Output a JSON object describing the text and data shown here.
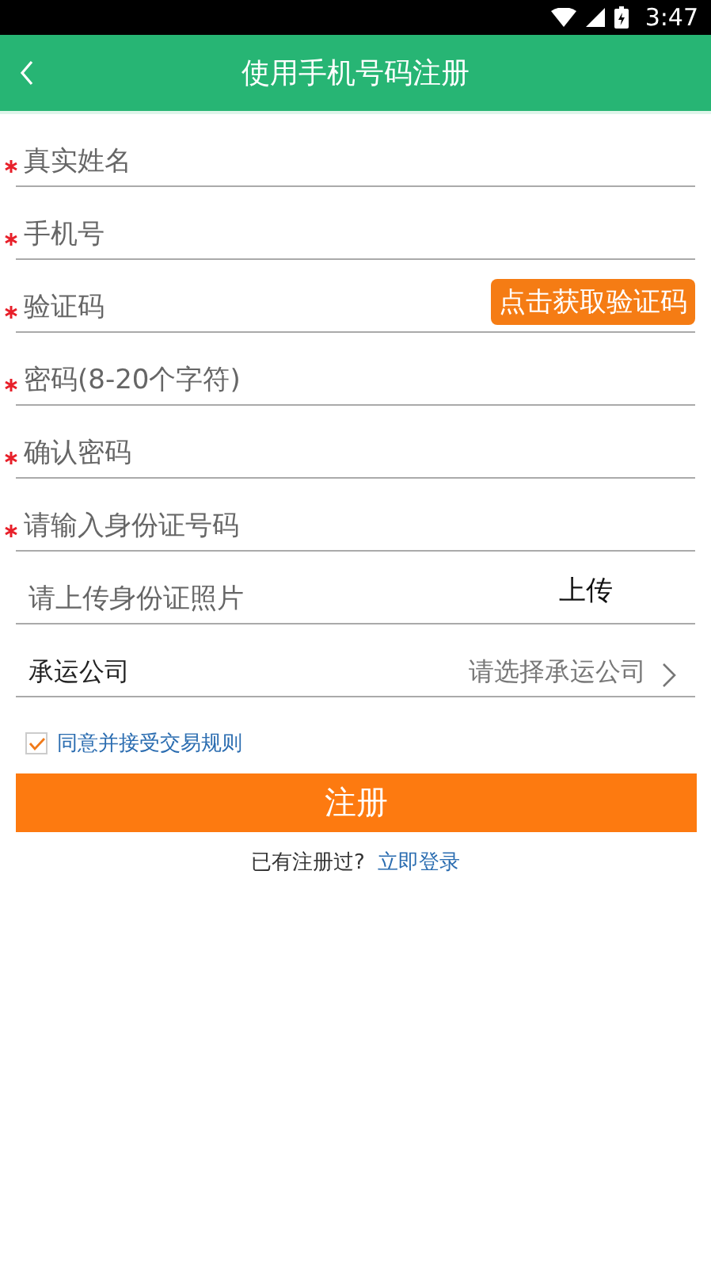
{
  "status_bar": {
    "time": "3:47"
  },
  "header": {
    "title": "使用手机号码注册"
  },
  "fields": [
    {
      "kind": "input",
      "required": true,
      "placeholder": "真实姓名"
    },
    {
      "kind": "input",
      "required": true,
      "placeholder": "手机号"
    },
    {
      "kind": "code",
      "required": true,
      "placeholder": "验证码",
      "button": "点击获取验证码"
    },
    {
      "kind": "input",
      "required": true,
      "placeholder": "密码(8-20个字符)"
    },
    {
      "kind": "input",
      "required": true,
      "placeholder": "确认密码"
    },
    {
      "kind": "input",
      "required": true,
      "placeholder": "请输入身份证号码"
    },
    {
      "kind": "upload",
      "required": false,
      "placeholder": "请上传身份证照片",
      "button": "上传"
    },
    {
      "kind": "select",
      "required": false,
      "label": "承运公司",
      "placeholder": "请选择承运公司"
    }
  ],
  "agreement": {
    "checked": true,
    "label": "同意并接受交易规则"
  },
  "submit": "注册",
  "login_prompt": {
    "text": "已有注册过?",
    "link": "立即登录"
  }
}
